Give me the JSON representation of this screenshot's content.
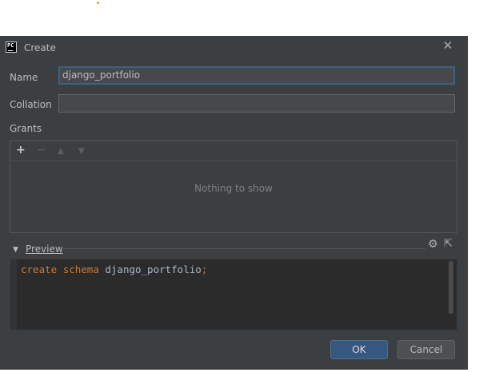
{
  "dialog": {
    "title": "Create",
    "app_icon_text": "PC",
    "close_icon": "close-icon"
  },
  "form": {
    "name_label": "Name",
    "name_value": "django_portfolio",
    "collation_label": "Collation",
    "collation_value": ""
  },
  "grants": {
    "label": "Grants",
    "toolbar": {
      "add_icon": "plus-icon",
      "remove_icon": "minus-icon",
      "up_icon": "move-up-icon",
      "down_icon": "move-down-icon"
    },
    "empty_text": "Nothing to show"
  },
  "preview": {
    "label": "Preview",
    "settings_icon": "gear-icon",
    "popout_icon": "popout-icon",
    "code": {
      "keyword1": "create",
      "keyword2": "schema",
      "identifier": "django_portfolio",
      "terminator": ";"
    }
  },
  "buttons": {
    "ok": "OK",
    "cancel": "Cancel"
  },
  "colors": {
    "dialog_bg": "#3c3f41",
    "editor_bg": "#2b2b2b",
    "keyword": "#cc7832",
    "identifier": "#a9b7c6",
    "ok_button": "#365880",
    "focus_border": "#3d6185"
  }
}
